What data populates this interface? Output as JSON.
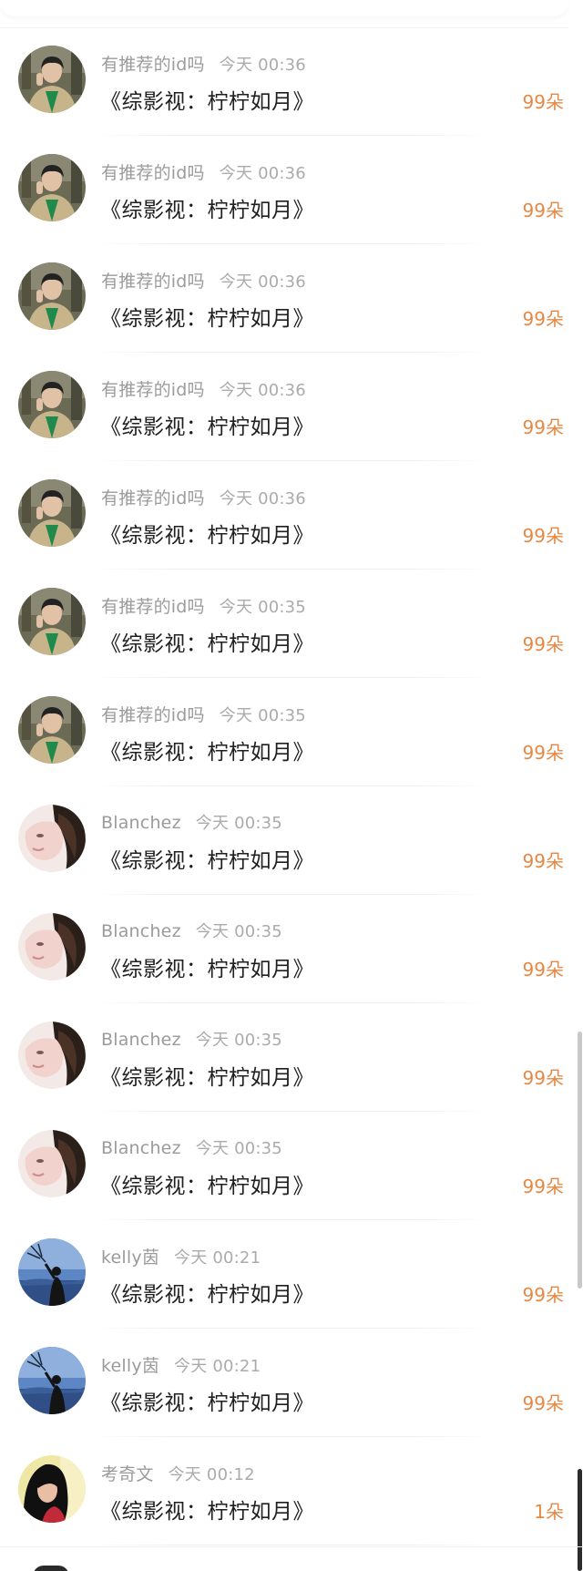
{
  "comments": [
    {
      "user": "有推荐的id吗",
      "time": "今天 00:36",
      "title": "《综影视：柠柠如月》",
      "gift": "99朵",
      "avatar": "man-jacket-avatar"
    },
    {
      "user": "有推荐的id吗",
      "time": "今天 00:36",
      "title": "《综影视：柠柠如月》",
      "gift": "99朵",
      "avatar": "man-jacket-avatar"
    },
    {
      "user": "有推荐的id吗",
      "time": "今天 00:36",
      "title": "《综影视：柠柠如月》",
      "gift": "99朵",
      "avatar": "man-jacket-avatar"
    },
    {
      "user": "有推荐的id吗",
      "time": "今天 00:36",
      "title": "《综影视：柠柠如月》",
      "gift": "99朵",
      "avatar": "man-jacket-avatar"
    },
    {
      "user": "有推荐的id吗",
      "time": "今天 00:36",
      "title": "《综影视：柠柠如月》",
      "gift": "99朵",
      "avatar": "man-jacket-avatar"
    },
    {
      "user": "有推荐的id吗",
      "time": "今天 00:35",
      "title": "《综影视：柠柠如月》",
      "gift": "99朵",
      "avatar": "man-jacket-avatar"
    },
    {
      "user": "有推荐的id吗",
      "time": "今天 00:35",
      "title": "《综影视：柠柠如月》",
      "gift": "99朵",
      "avatar": "man-jacket-avatar"
    },
    {
      "user": "Blanchez",
      "time": "今天 00:35",
      "title": "《综影视：柠柠如月》",
      "gift": "99朵",
      "avatar": "portrait-avatar"
    },
    {
      "user": "Blanchez",
      "time": "今天 00:35",
      "title": "《综影视：柠柠如月》",
      "gift": "99朵",
      "avatar": "portrait-avatar"
    },
    {
      "user": "Blanchez",
      "time": "今天 00:35",
      "title": "《综影视：柠柠如月》",
      "gift": "99朵",
      "avatar": "portrait-avatar"
    },
    {
      "user": "Blanchez",
      "time": "今天 00:35",
      "title": "《综影视：柠柠如月》",
      "gift": "99朵",
      "avatar": "portrait-avatar"
    },
    {
      "user": "kelly茵",
      "time": "今天 00:21",
      "title": "《综影视：柠柠如月》",
      "gift": "99朵",
      "avatar": "silhouette-sky-avatar"
    },
    {
      "user": "kelly茵",
      "time": "今天 00:21",
      "title": "《综影视：柠柠如月》",
      "gift": "99朵",
      "avatar": "silhouette-sky-avatar"
    },
    {
      "user": "考奇文",
      "time": "今天 00:12",
      "title": "《综影视：柠柠如月》",
      "gift": "1朵",
      "avatar": "girl-dark-hair-avatar"
    }
  ],
  "colors": {
    "username": "#9b9b9b",
    "title": "#1f1f1f",
    "gift": "#e68843",
    "divider": "#eeeeee"
  }
}
